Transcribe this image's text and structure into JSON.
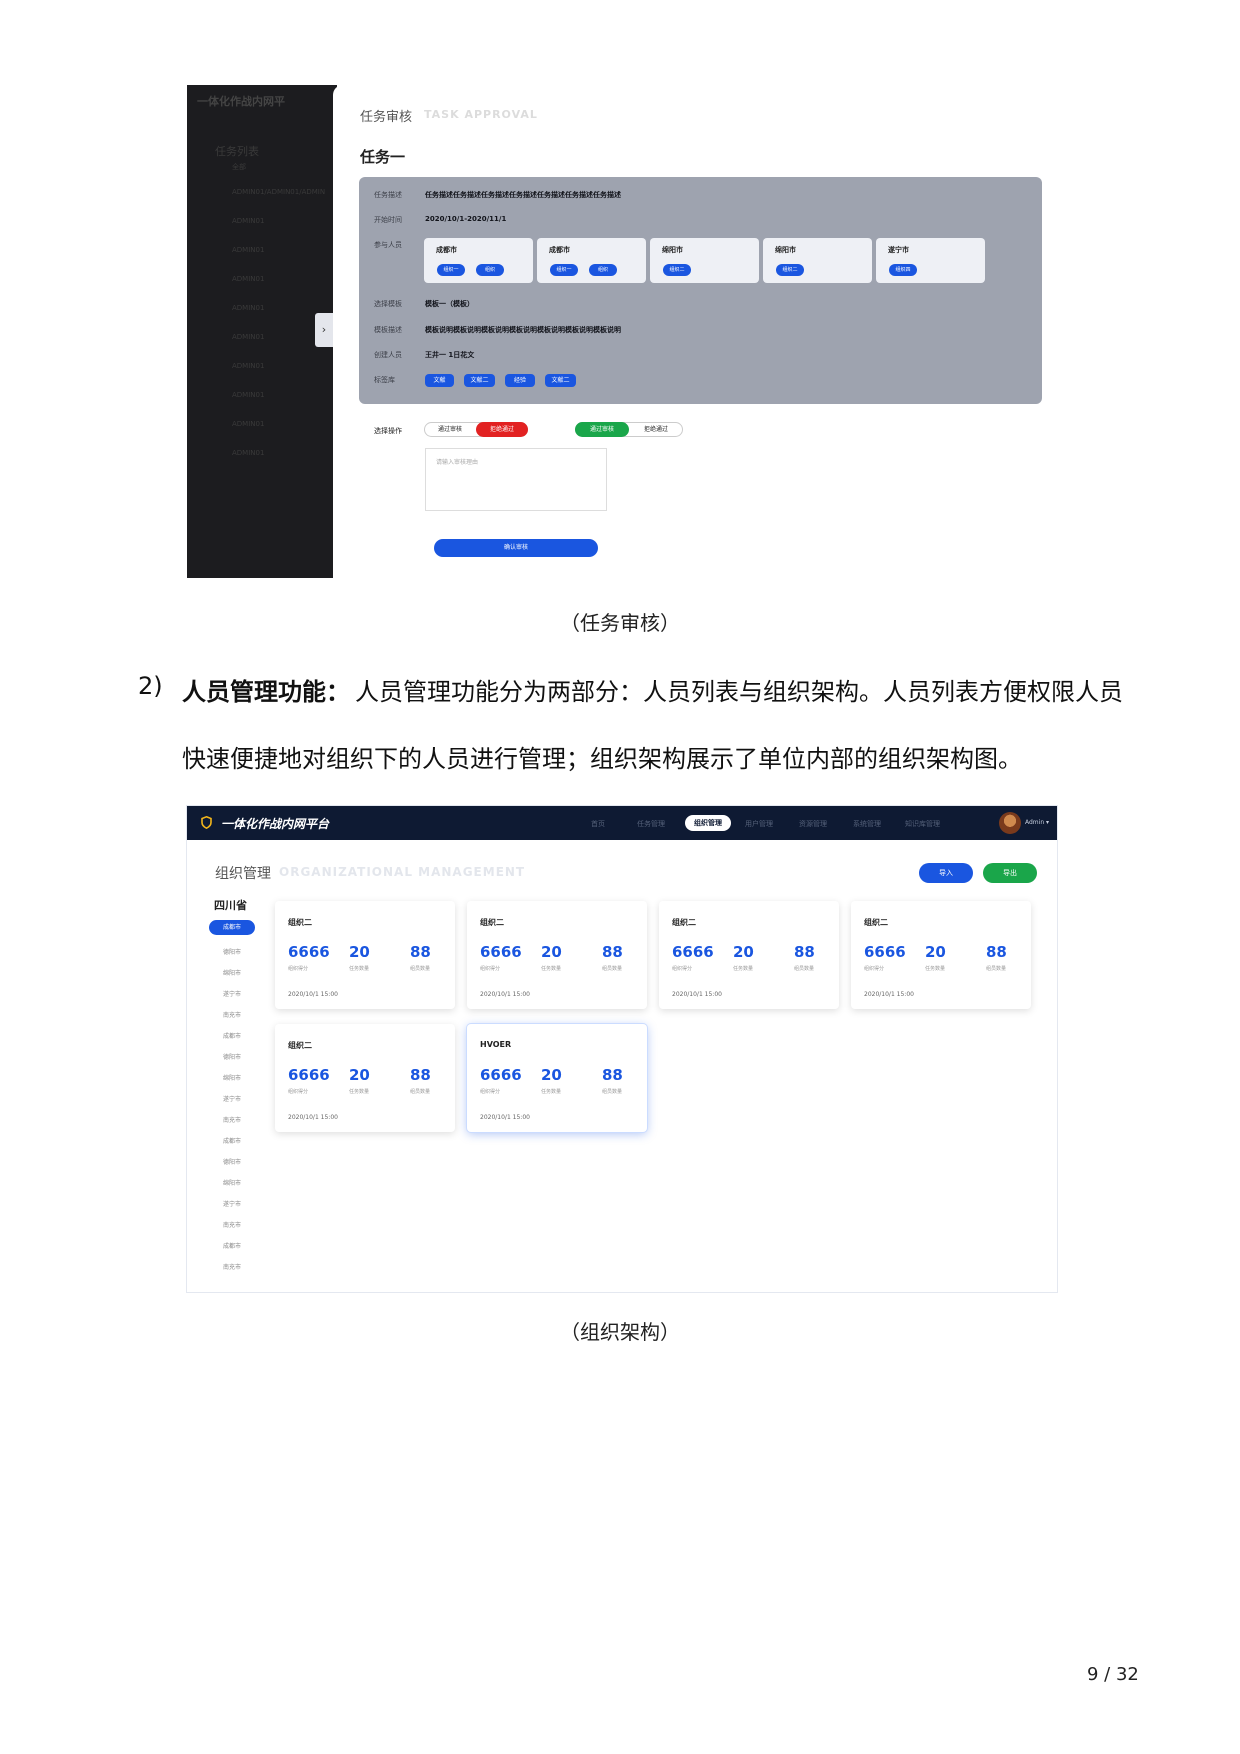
{
  "shot1": {
    "sidebar": {
      "brand": "一体化作战内网平",
      "title": "任务列表",
      "items": [
        "全部",
        "ADMIN01/ADMIN01/ADMIN",
        "ADMIN01",
        "ADMIN01",
        "ADMIN01",
        "ADMIN01",
        "ADMIN01",
        "ADMIN01",
        "ADMIN01",
        "ADMIN01",
        "ADMIN01"
      ]
    },
    "toggle": "›",
    "heading": "任务审核",
    "heading_en": "TASK APPROVAL",
    "task_title": "任务一",
    "fields": {
      "desc_label": "任务描述",
      "desc_value": "任务描述任务描述任务描述任务描述任务描述任务描述任务描述",
      "time_label": "开始时间",
      "time_value": "2020/10/1-2020/11/1",
      "people_label": "参与人员",
      "template_label": "选择模板",
      "template_value": "模板一（模板）",
      "template_desc_label": "模板描述",
      "template_desc_value": "模板说明模板说明模板说明模板说明模板说明模板说明模板说明",
      "builder_label": "创建人员",
      "builder_value": "王井一 1日花文",
      "tags_label": "标签库"
    },
    "cities": [
      {
        "name": "成都市",
        "pills": [
          "组织一",
          "组织"
        ]
      },
      {
        "name": "成都市",
        "pills": [
          "组织一",
          "组织"
        ]
      },
      {
        "name": "绵阳市",
        "pills": [
          "组织二"
        ]
      },
      {
        "name": "绵阳市",
        "pills": [
          "组织二"
        ]
      },
      {
        "name": "遂宁市",
        "pills": [
          "组织四"
        ]
      }
    ],
    "tags": [
      "文献",
      "文献二",
      "经验",
      "文献二"
    ],
    "action_label": "选择操作",
    "seg_left": [
      "通过审核",
      "拒绝通过"
    ],
    "seg_right": [
      "通过审核",
      "拒绝通过"
    ],
    "textarea_placeholder": "请输入审核理由",
    "confirm_label": "确认审核",
    "colors": {
      "accent": "#1a56e0",
      "reject": "#e22222",
      "approve": "#1aa64a"
    }
  },
  "caption1": "（任务审核）",
  "para_num": "2)",
  "para_bold": "人员管理功能：",
  "para_line1": "人员管理功能分为两部分：人员列表与组织架构。人员列表方便权限人员",
  "para_line2": "快速便捷地对组织下的人员进行管理；组织架构展示了单位内部的组织架构图。",
  "shot2": {
    "brand": "一体化作战内网平台",
    "nav": [
      "首页",
      "任务管理",
      "组织管理",
      "用户管理",
      "资源管理",
      "系统管理",
      "知识库管理"
    ],
    "nav_active": "组织管理",
    "admin": "Admin ▾",
    "title": "组织管理",
    "title_en": "ORGANIZATIONAL MANAGEMENT",
    "import_label": "导入",
    "export_label": "导出",
    "province": "四川省",
    "city_active": "成都市",
    "cities": [
      "德阳市",
      "绵阳市",
      "遂宁市",
      "南充市",
      "成都市",
      "德阳市",
      "绵阳市",
      "遂宁市",
      "南充市",
      "成都市",
      "德阳市",
      "绵阳市",
      "遂宁市",
      "南充市",
      "成都市",
      "南充市"
    ],
    "cards": [
      {
        "name": "组织二",
        "score": "6666",
        "tasks": "20",
        "members": "88",
        "date": "2020/10/1 15:00"
      },
      {
        "name": "组织二",
        "score": "6666",
        "tasks": "20",
        "members": "88",
        "date": "2020/10/1 15:00"
      },
      {
        "name": "组织二",
        "score": "6666",
        "tasks": "20",
        "members": "88",
        "date": "2020/10/1 15:00"
      },
      {
        "name": "组织二",
        "score": "6666",
        "tasks": "20",
        "members": "88",
        "date": "2020/10/1 15:00"
      },
      {
        "name": "组织二",
        "score": "6666",
        "tasks": "20",
        "members": "88",
        "date": "2020/10/1 15:00"
      },
      {
        "name": "HVOER",
        "score": "6666",
        "tasks": "20",
        "members": "88",
        "date": "2020/10/1 15:00"
      }
    ],
    "stat_labels": [
      "组织得分",
      "任务数量",
      "组员数量"
    ],
    "colors": {
      "import": "#1a56e0",
      "export": "#1aa64a",
      "topbar": "#0e1a33"
    }
  },
  "caption2": "（组织架构）",
  "page_number": "9 / 32"
}
